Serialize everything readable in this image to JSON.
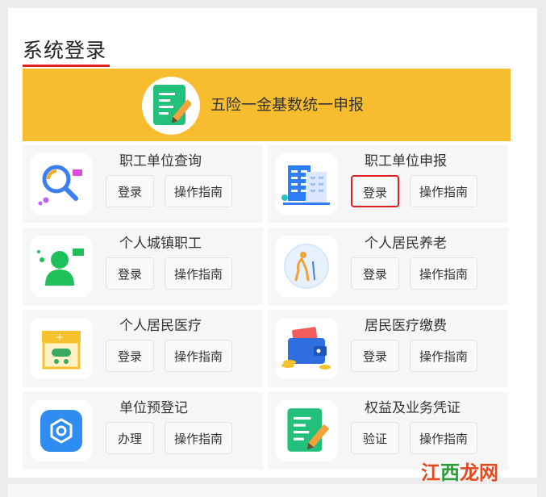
{
  "page": {
    "title": "系统登录"
  },
  "banner": {
    "label": "五险一金基数统一申报"
  },
  "cards": [
    {
      "title": "职工单位查询",
      "primary_label": "登录",
      "guide_label": "操作指南"
    },
    {
      "title": "职工单位申报",
      "primary_label": "登录",
      "guide_label": "操作指南"
    },
    {
      "title": "个人城镇职工",
      "primary_label": "登录",
      "guide_label": "操作指南"
    },
    {
      "title": "个人居民养老",
      "primary_label": "登录",
      "guide_label": "操作指南"
    },
    {
      "title": "个人居民医疗",
      "primary_label": "登录",
      "guide_label": "操作指南"
    },
    {
      "title": "居民医疗缴费",
      "primary_label": "登录",
      "guide_label": "操作指南"
    },
    {
      "title": "单位预登记",
      "primary_label": "办理",
      "guide_label": "操作指南"
    },
    {
      "title": "权益及业务凭证",
      "primary_label": "验证",
      "guide_label": "操作指南"
    }
  ],
  "watermark": {
    "text_a": "江",
    "text_b": "西",
    "text_c": "龙网"
  },
  "colors": {
    "banner_bg": "#f8bd2f",
    "highlight": "#e02020",
    "accent_green": "#22c07a"
  }
}
